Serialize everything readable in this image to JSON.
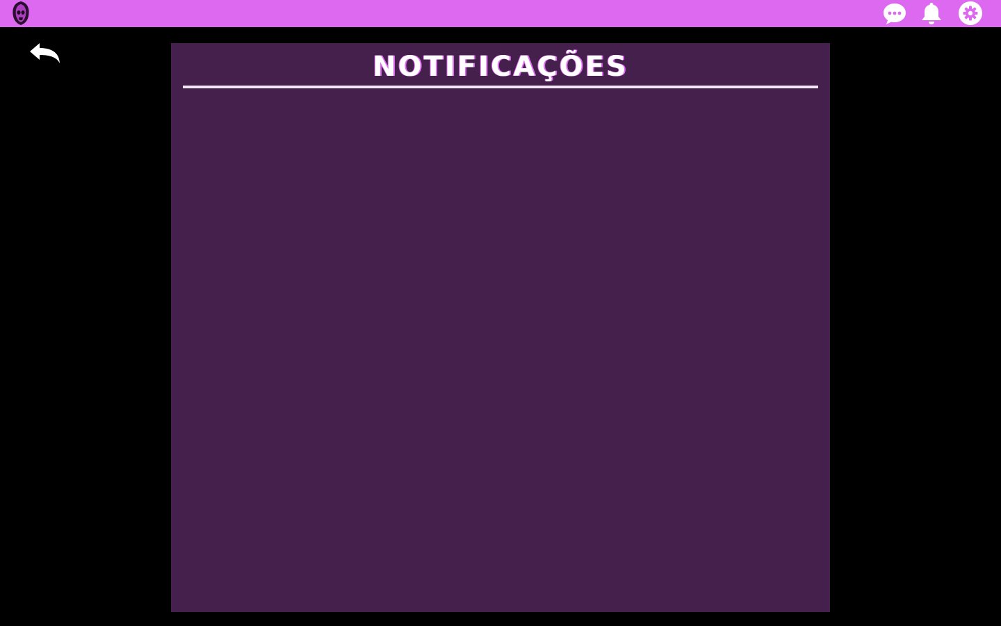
{
  "app": {
    "logo_icon": "hooded-skull-logo"
  },
  "header": {
    "icons": [
      "chat-bubble-icon",
      "bell-icon",
      "gear-icon"
    ]
  },
  "nav": {
    "back_icon": "back-arrow-icon"
  },
  "notifications": {
    "title": "NOTIFICAÇÕES",
    "items": []
  },
  "colors": {
    "topbar": "#dd69f0",
    "background": "#000000",
    "panel": "#45204c",
    "title": "#ffffff",
    "divider": "#f3e6f5"
  }
}
